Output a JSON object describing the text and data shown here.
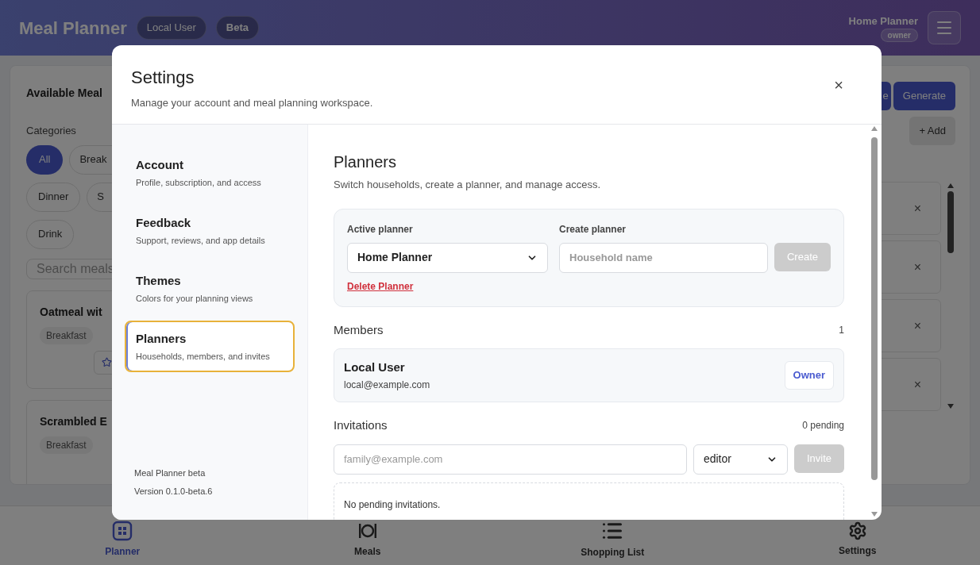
{
  "header": {
    "title": "Meal Planner",
    "badges": [
      {
        "label": "Local User",
        "kind": "plain"
      },
      {
        "label": "Beta",
        "kind": "bold"
      }
    ],
    "planner_name": "Home Planner",
    "role": "owner"
  },
  "meals_panel": {
    "title": "Available Meal",
    "categories_label": "Categories",
    "categories": [
      {
        "label": "All",
        "selected": true
      },
      {
        "label": "Break",
        "selected": false
      },
      {
        "label": "Dinner",
        "selected": false
      },
      {
        "label": "S",
        "selected": false
      },
      {
        "label": "Drink",
        "selected": false
      }
    ],
    "search": {
      "placeholder": "Search meals"
    },
    "meals": [
      {
        "name": "Oatmeal wit",
        "tag": "Breakfast",
        "favorite": false
      },
      {
        "name": "Scrambled E",
        "tag": "Breakfast"
      }
    ]
  },
  "plan_panel": {
    "buttons": [
      "e",
      "Generate"
    ],
    "add_button": "+ Add",
    "slots": [
      {
        "remove": "×"
      },
      {
        "remove": "×"
      },
      {
        "remove": "×"
      },
      {
        "remove": "×"
      }
    ]
  },
  "settings": {
    "title": "Settings",
    "subtitle": "Manage your account and meal planning workspace.",
    "close": "×",
    "nav": [
      {
        "title": "Account",
        "description": "Profile, subscription, and access",
        "selected": false
      },
      {
        "title": "Feedback",
        "description": "Support, reviews, and app details",
        "selected": false
      },
      {
        "title": "Themes",
        "description": "Colors for your planning views",
        "selected": false
      },
      {
        "title": "Planners",
        "description": "Households, members, and invites",
        "selected": true
      }
    ],
    "footer": [
      "Meal Planner beta",
      "Version 0.1.0-beta.6"
    ],
    "section": {
      "title": "Planners",
      "subtitle": "Switch households, create a planner, and manage access.",
      "active_label": "Active planner",
      "active_value": "Home Planner",
      "create_label": "Create planner",
      "create_placeholder": "Household name",
      "create_button": {
        "label": "Create",
        "disabled": true
      },
      "delete_link": "Delete Planner",
      "members_label": "Members",
      "members_count": "1",
      "members": [
        {
          "name": "Local User",
          "email": "local@example.com",
          "role": "Owner"
        }
      ],
      "invitations_label": "Invitations",
      "invitations_count": "0 pending",
      "invite_placeholder": "family@example.com",
      "invite_role": "editor",
      "invite_button": {
        "label": "Invite",
        "disabled": true
      },
      "empty": "No pending invitations."
    }
  },
  "bottom_nav": [
    {
      "label": "Planner",
      "kind": "grid",
      "selected": true
    },
    {
      "label": "Meals",
      "kind": "plate",
      "selected": false
    },
    {
      "label": "Shopping List",
      "kind": "list",
      "selected": false
    },
    {
      "label": "Settings",
      "kind": "gear",
      "selected": false
    }
  ]
}
